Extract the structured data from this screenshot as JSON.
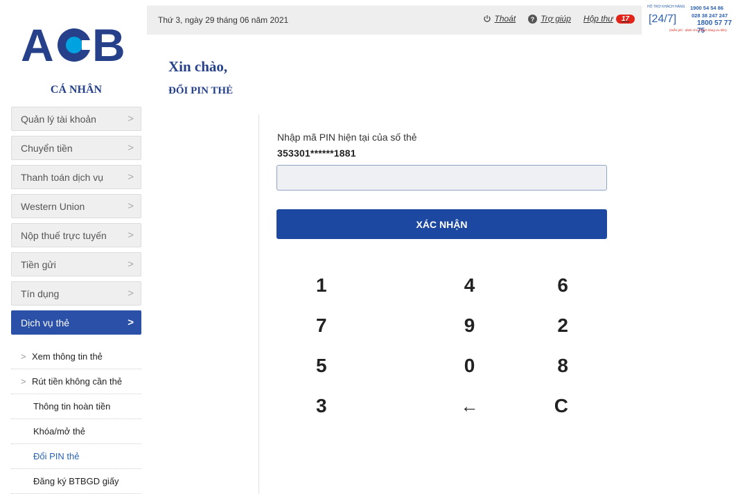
{
  "header": {
    "date": "Thứ 3, ngày 29 tháng 06 năm 2021",
    "logout_label": "Thoát",
    "help_label": "Trợ giúp",
    "inbox_label": "Hộp thư",
    "inbox_count": "17",
    "hotline": {
      "label": "HỖ TRỢ KHÁCH HÀNG",
      "badge": "[24/7]",
      "phone1": "1900 54 54 86",
      "phone2": "028 38 247 247",
      "phone3": "1800 57 77 75",
      "note": "(miễn phí - dành cho khách hàng ưu tiên)"
    }
  },
  "brand": {
    "logo_text": "ACB",
    "section": "CÁ NHÂN",
    "colors": {
      "primary": "#26408a",
      "accent": "#1d48a2",
      "circle": "#00a3e0"
    }
  },
  "sidebar": {
    "items": [
      {
        "label": "Quản lý tài khoản",
        "icon": "chevron-right-icon"
      },
      {
        "label": "Chuyển tiền",
        "icon": "chevron-right-icon"
      },
      {
        "label": "Thanh toán dịch vụ",
        "icon": "chevron-right-icon"
      },
      {
        "label": "Western Union",
        "icon": "chevron-right-icon"
      },
      {
        "label": "Nộp thuế trực tuyến",
        "icon": "chevron-right-icon"
      },
      {
        "label": "Tiền gửi",
        "icon": "chevron-right-icon"
      },
      {
        "label": "Tín dụng",
        "icon": "chevron-right-icon"
      },
      {
        "label": "Dịch vụ thẻ",
        "icon": "chevron-right-icon",
        "active": true
      }
    ],
    "subitems": [
      {
        "label": "Xem thông tin thẻ",
        "has_chevron": true
      },
      {
        "label": "Rút tiền không cần thẻ",
        "has_chevron": true
      },
      {
        "label": "Thông tin hoàn tiền",
        "has_chevron": false
      },
      {
        "label": "Khóa/mở thẻ",
        "has_chevron": false
      },
      {
        "label": "Đổi PIN thẻ",
        "has_chevron": false,
        "current": true
      },
      {
        "label": "Đăng ký BTBGD giấy",
        "has_chevron": false
      }
    ]
  },
  "main": {
    "greeting": "Xin chào,",
    "title": "ĐỔI PIN THẺ",
    "pin_prompt": "Nhập mã PIN hiện tại của số thẻ",
    "card_number": "353301******1881",
    "pin_value": "",
    "confirm_label": "XÁC NHẬN",
    "keypad": [
      "1",
      "4",
      "6",
      "7",
      "9",
      "2",
      "5",
      "0",
      "8",
      "3",
      "←",
      "C"
    ]
  }
}
